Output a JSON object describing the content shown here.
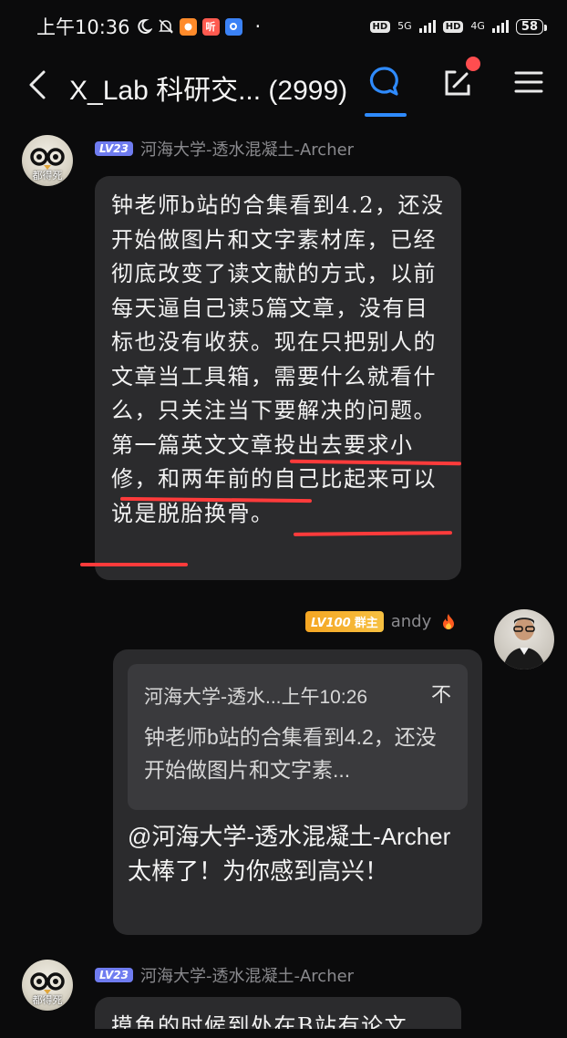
{
  "status_bar": {
    "time": "上午10:36",
    "app_badge_1": "听",
    "dot": "·",
    "hd1": "HD",
    "net1": "5G",
    "hd2": "HD",
    "net2": "4G",
    "battery": "58"
  },
  "header": {
    "title": "X_Lab 科研交... (2999)"
  },
  "messages": [
    {
      "level": "LV23",
      "sender": "河海大学-透水混凝土-Archer",
      "avatar_caption": "都得死",
      "text": "钟老师b站的合集看到4.2，还没开始做图片和文字素材库，已经彻底改变了读文献的方式，以前每天逼自己读5篇文章，没有目标也没有收获。现在只把别人的文章当工具箱，需要什么就看什么，只关注当下要解决的问题。第一篇英文文章投出去要求小修，和两年前的自己比起来可以说是脱胎换骨。"
    },
    {
      "level": "LV100",
      "owner_tag": "群主",
      "sender": "andy",
      "quote_header": "河海大学-透水...上午10:26",
      "quote_close": "不",
      "quote_text": "钟老师b站的合集看到4.2，还没开始做图片和文字素...",
      "text": "@河海大学-透水混凝土-Archer 太棒了！为你感到高兴！"
    },
    {
      "level": "LV23",
      "sender": "河海大学-透水混凝土-Archer",
      "avatar_caption": "都得死",
      "text": "摸鱼的时候到处在B站有论文"
    }
  ],
  "colors": {
    "accent_blue": "#2f8bff",
    "annotation_red": "#ff3b3b",
    "level_badge": "#6f7cf0",
    "owner_badge": "#f5a623"
  }
}
